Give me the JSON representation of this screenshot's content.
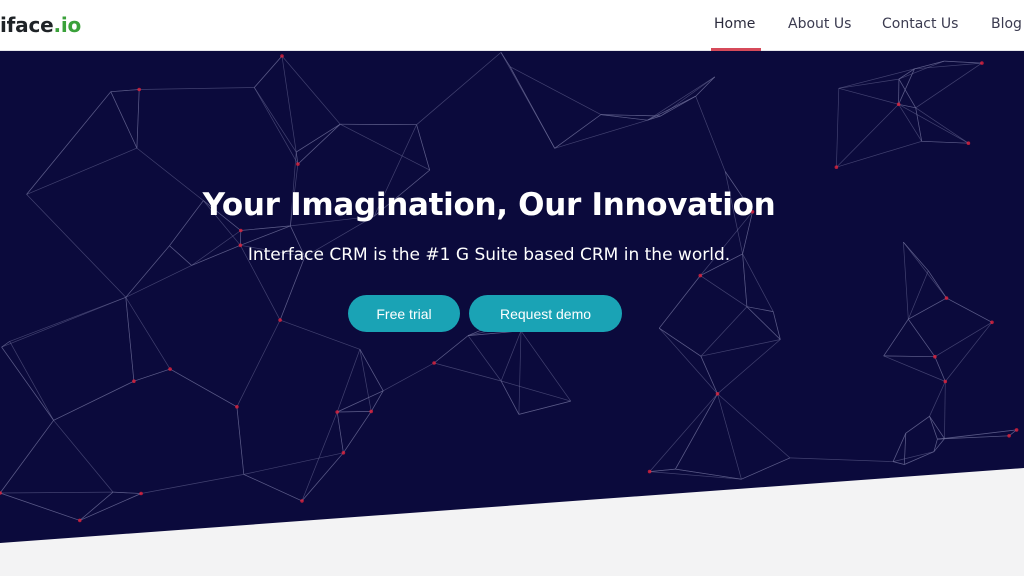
{
  "brand": {
    "logo_main": "iface",
    "logo_suffix": ".io"
  },
  "nav": {
    "items": [
      {
        "label": "Home",
        "active": true
      },
      {
        "label": "About Us"
      },
      {
        "label": "Contact Us"
      },
      {
        "label": "Blog"
      }
    ]
  },
  "hero": {
    "title": "Your Imagination, Our Innovation",
    "subtitle": "Interface CRM is the #1 G Suite based CRM in the world.",
    "primary_button": "Free trial",
    "secondary_button": "Request demo"
  },
  "colors": {
    "hero_background": "#0b0a3c",
    "nav_active_underline": "#d64a5a",
    "button": "#1aa3b5",
    "logo_accent": "#3aa13a",
    "network_lines": "#6f6f9a",
    "network_nodes": "#e0203a",
    "section_below": "#f3f3f4"
  }
}
